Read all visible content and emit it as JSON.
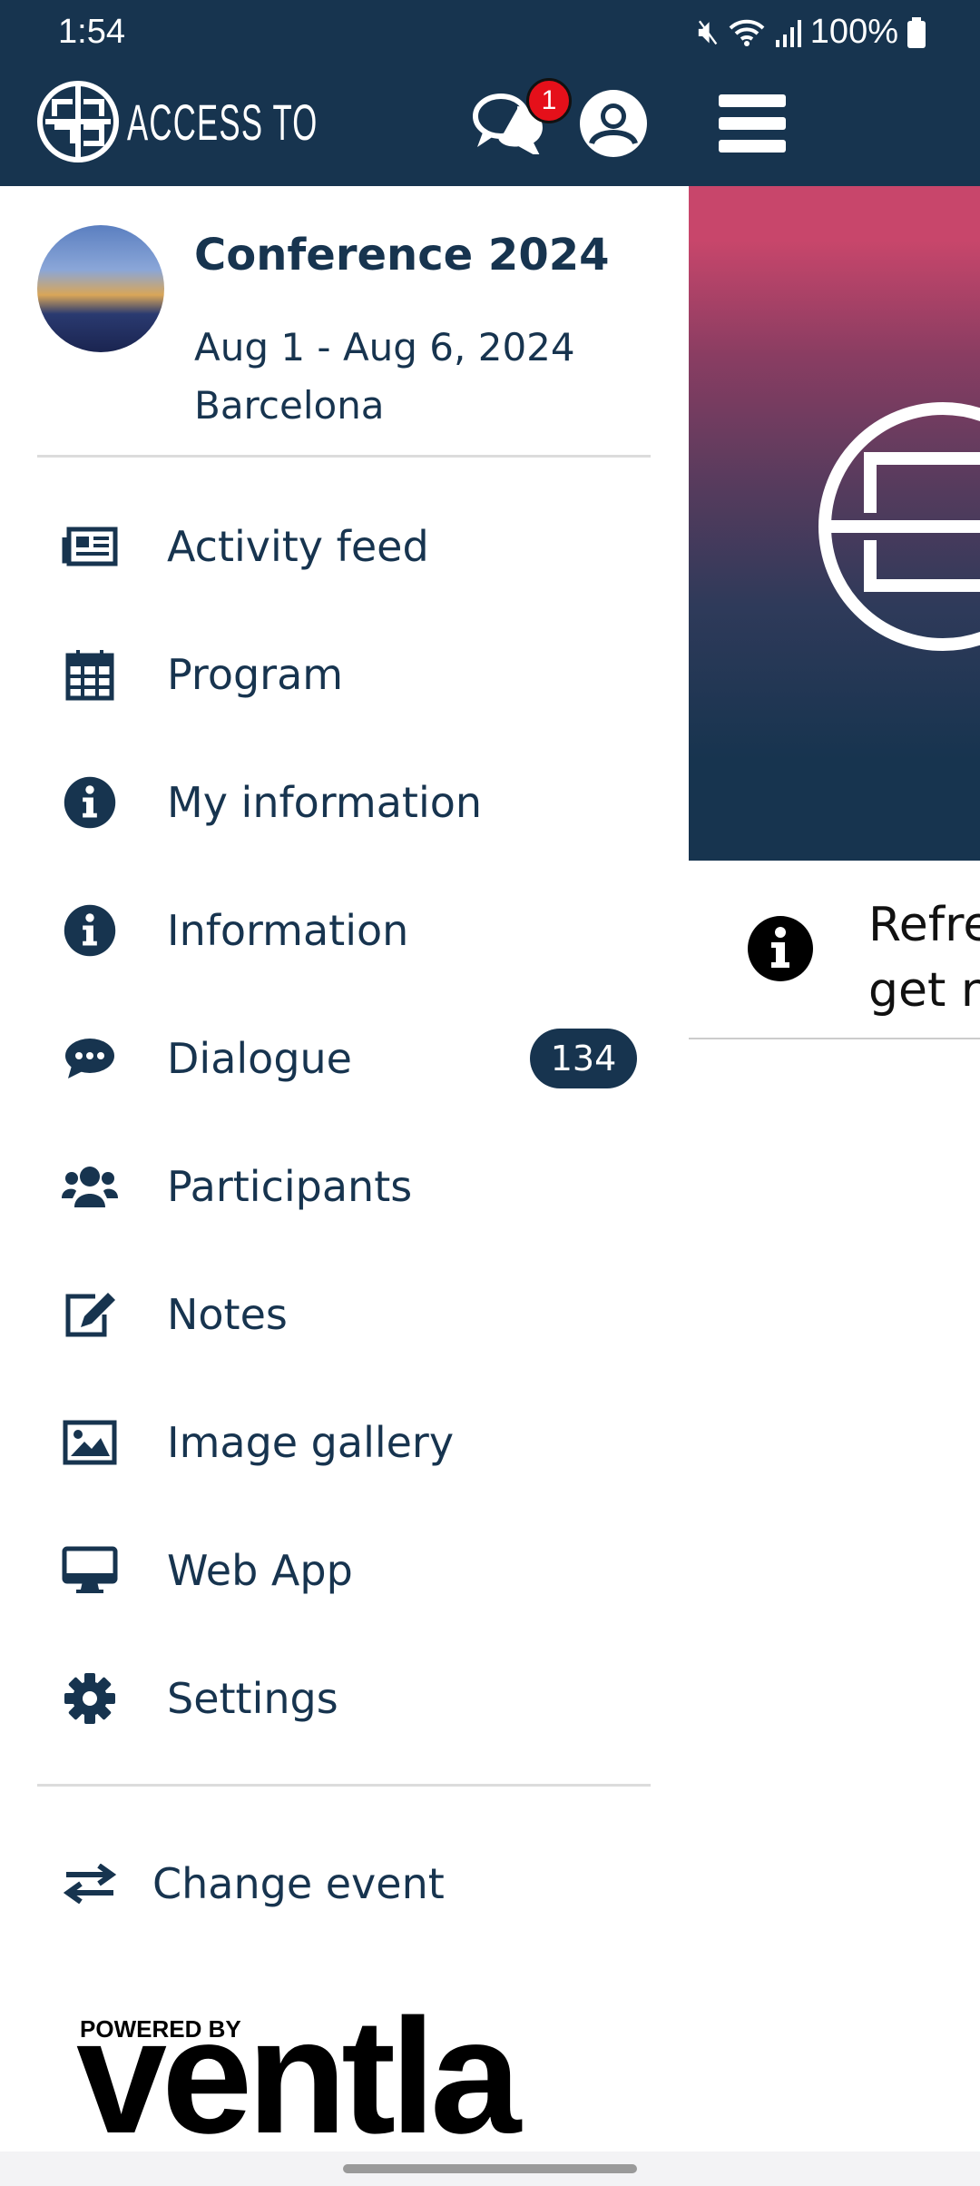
{
  "status_bar": {
    "time": "1:54",
    "battery": "100%"
  },
  "header": {
    "brand": "ACCESS TO",
    "chat_badge": "1"
  },
  "event": {
    "title": "Conference 2024",
    "dates": "Aug 1 - Aug 6, 2024",
    "location": "Barcelona"
  },
  "menu": [
    {
      "label": "Activity feed",
      "icon": "newspaper-icon"
    },
    {
      "label": "Program",
      "icon": "calendar-icon"
    },
    {
      "label": "My information",
      "icon": "info-circle-icon"
    },
    {
      "label": "Information",
      "icon": "info-circle-icon"
    },
    {
      "label": "Dialogue",
      "icon": "comment-dots-icon",
      "count": "134"
    },
    {
      "label": "Participants",
      "icon": "users-icon"
    },
    {
      "label": "Notes",
      "icon": "edit-icon"
    },
    {
      "label": "Image gallery",
      "icon": "image-icon"
    },
    {
      "label": "Web App",
      "icon": "desktop-icon"
    },
    {
      "label": "Settings",
      "icon": "gear-icon"
    }
  ],
  "change_event": "Change event",
  "footer": {
    "powered_by": "POWERED BY",
    "brand": "ventla"
  },
  "background": {
    "info_text_line1": "Refre",
    "info_text_line2": "get re"
  },
  "colors": {
    "primary": "#17344f",
    "badge": "#e5101a",
    "banner_top": "#c8466b"
  }
}
